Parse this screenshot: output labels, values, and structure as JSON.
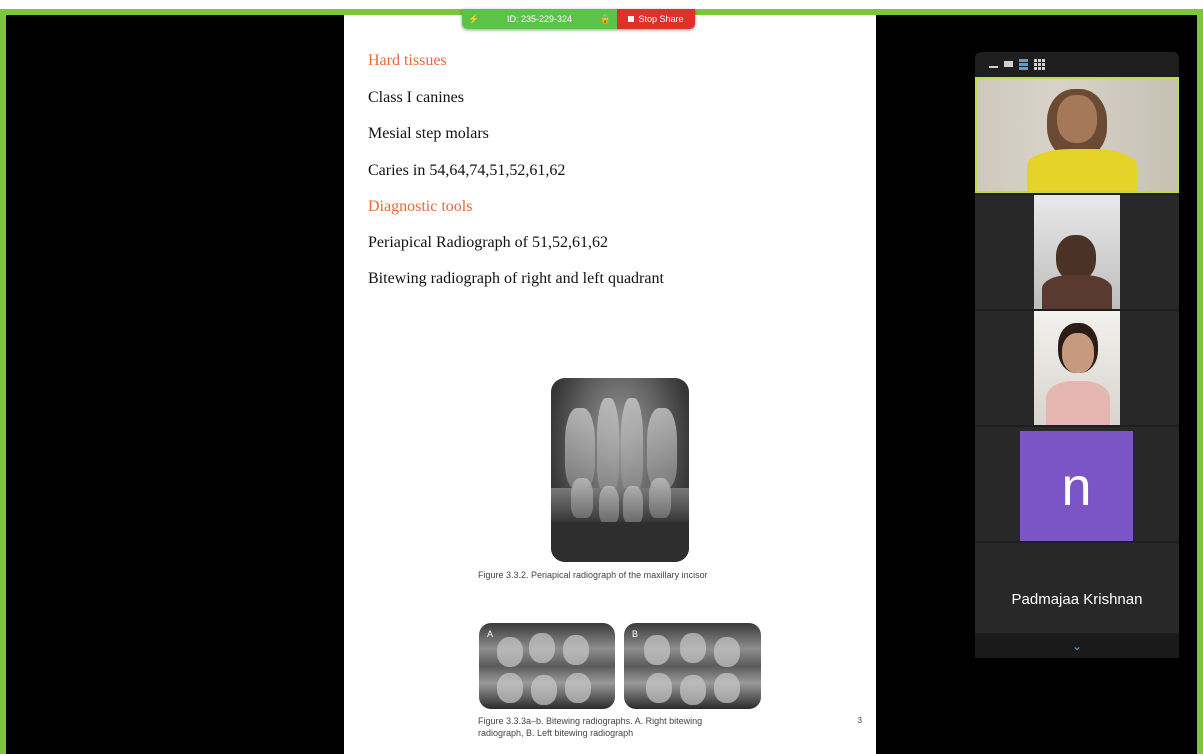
{
  "share_toolbar": {
    "meeting_id": "ID: 235-229-324",
    "stop_share_label": "Stop Share"
  },
  "document": {
    "sections": [
      {
        "type": "heading",
        "text": "Hard tissues"
      },
      {
        "type": "line",
        "text": "Class I canines"
      },
      {
        "type": "line",
        "text": "Mesial step molars"
      },
      {
        "type": "line",
        "text": "Caries in 54,64,74,51,52,61,62"
      },
      {
        "type": "heading",
        "text": "Diagnostic tools"
      },
      {
        "type": "line",
        "text": "Periapical Radiograph of 51,52,61,62"
      },
      {
        "type": "line",
        "text": "Bitewing radiograph of right and left quadrant"
      }
    ],
    "figure1_caption": "Figure 3.3.2.  Periapical radiograph of the maxillary incisor",
    "figure2_caption_line1": "Figure 3.3.3a–b.  Bitewing radiographs. A. Right bitewing",
    "figure2_caption_line2": "radiograph, B. Left bitewing radiograph",
    "bitewing_a_label": "A",
    "bitewing_b_label": "B",
    "page_number": "3"
  },
  "participants": {
    "avatar_initial": "n",
    "name_tile": "Padmajaa Krishnan"
  },
  "colors": {
    "share_border": "#7dc53a",
    "heading": "#e8683a",
    "toolbar_green": "#5cc34a",
    "toolbar_red": "#e0302c",
    "avatar_purple": "#7b55c6",
    "active_speaker": "#b8e045"
  }
}
